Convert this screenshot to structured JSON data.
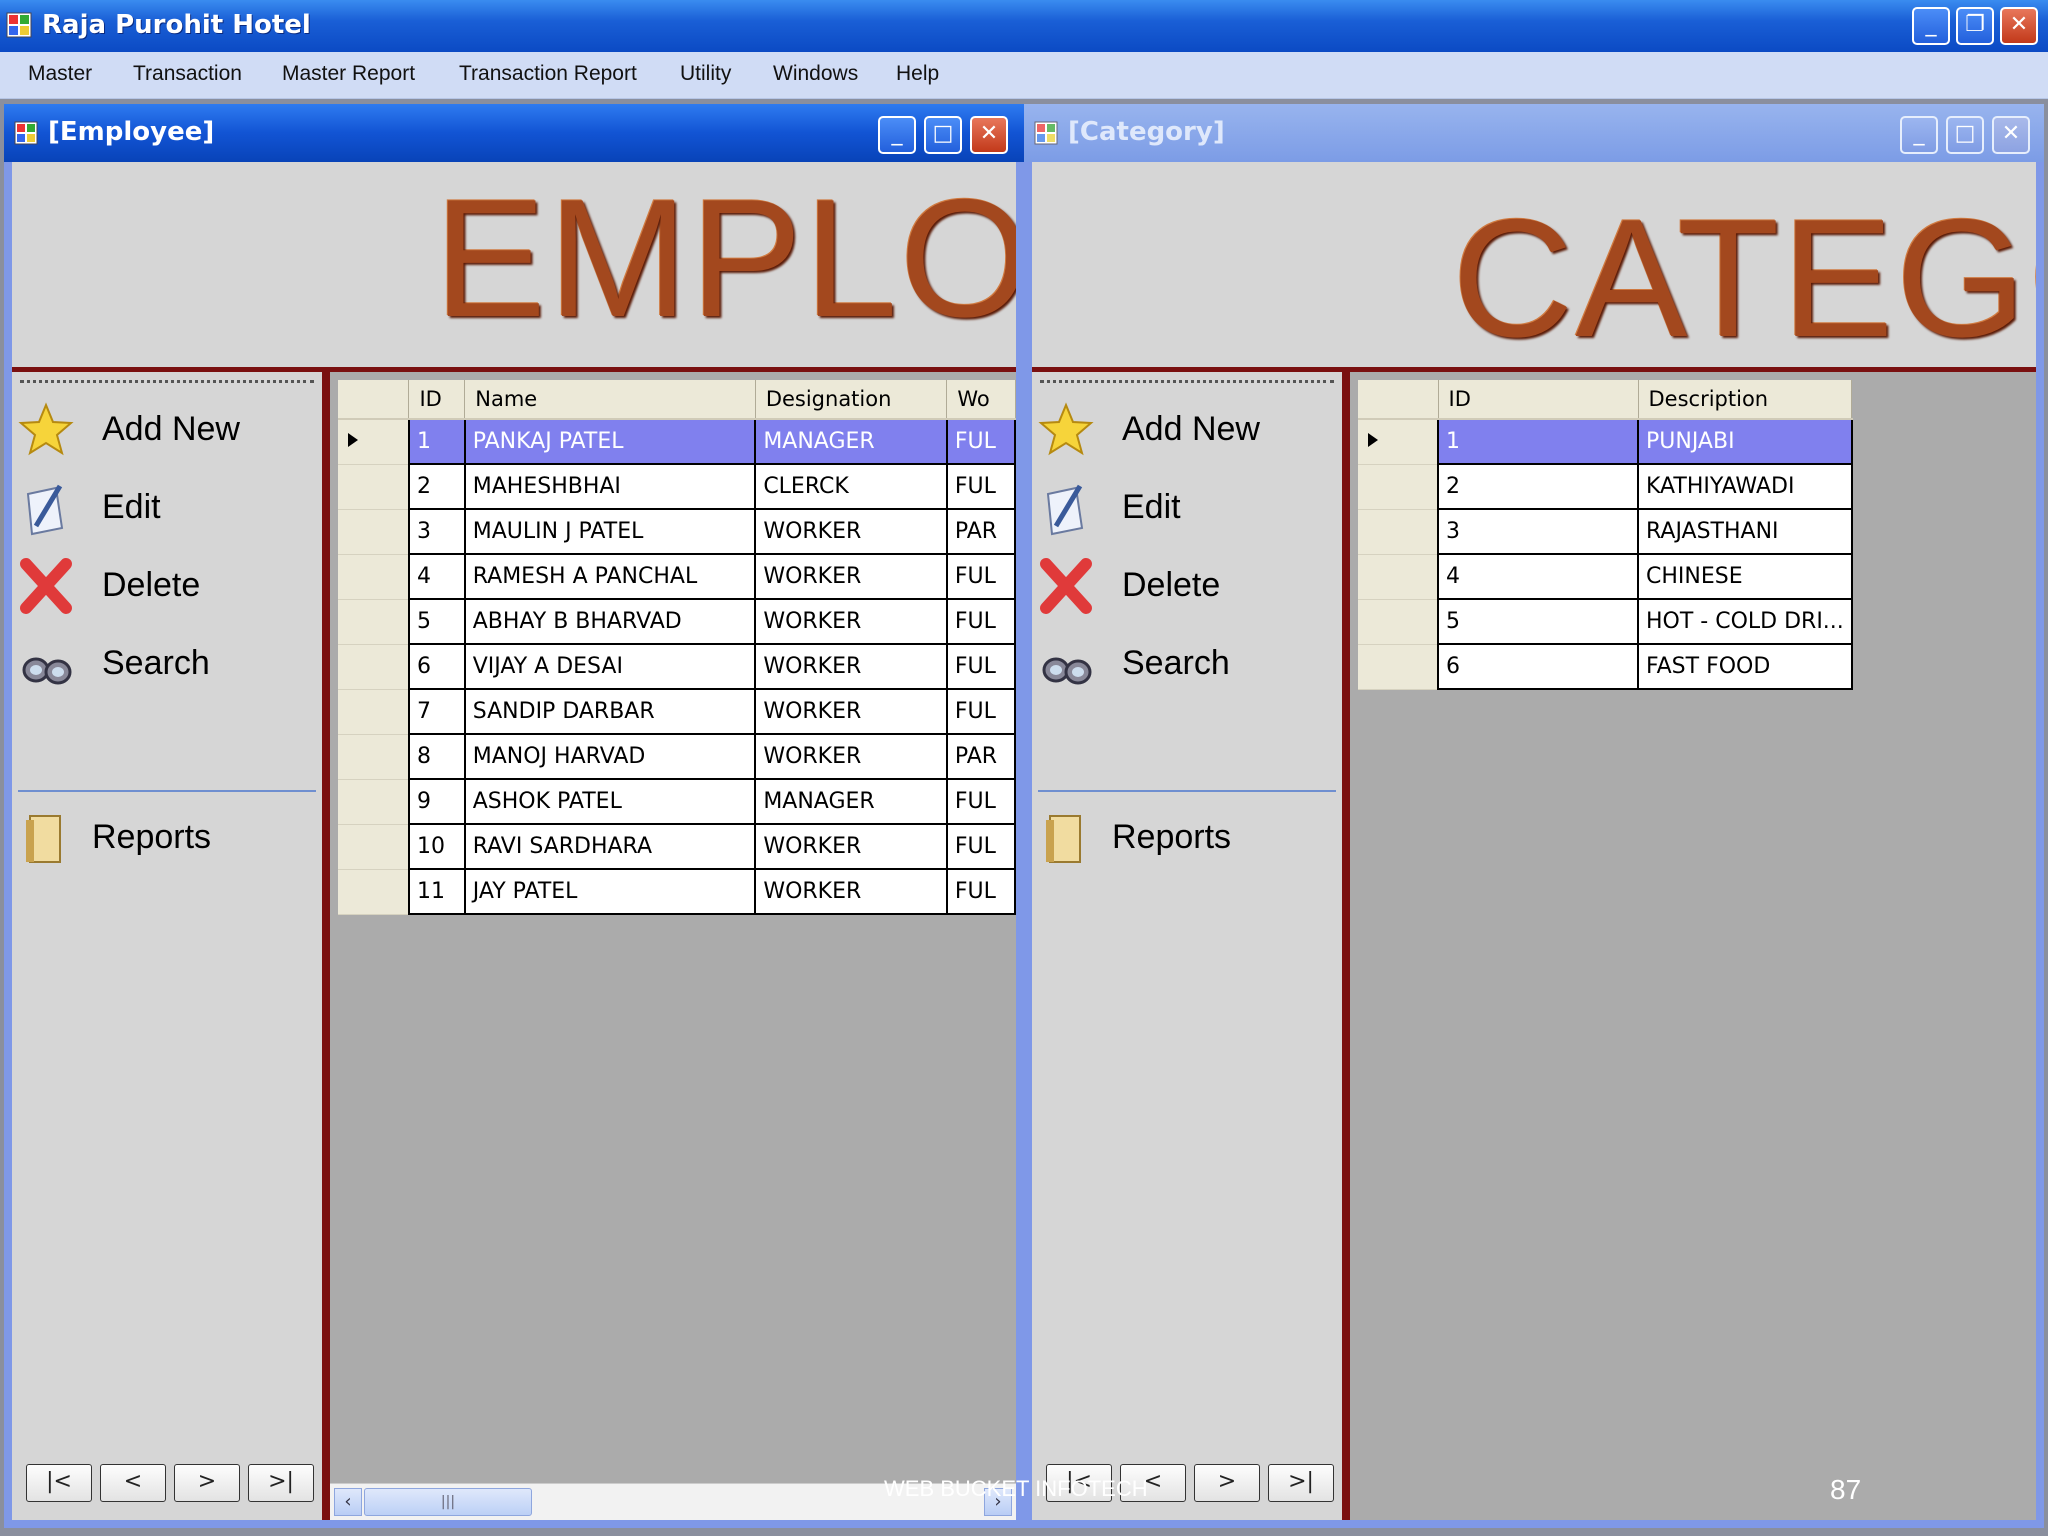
{
  "app": {
    "title": "Raja Purohit Hotel"
  },
  "menu": [
    "Master",
    "Transaction",
    "Master Report",
    "Transaction Report",
    "Utility",
    "Windows",
    "Help"
  ],
  "window_buttons": {
    "minimize": "_",
    "maximize": "□",
    "restore": "❐",
    "close": "✕"
  },
  "side": {
    "add_new": "Add New",
    "edit": "Edit",
    "delete": "Delete",
    "search": "Search",
    "reports": "Reports",
    "nav": {
      "first": "|<",
      "prev": "<",
      "next": ">",
      "last": ">|"
    }
  },
  "employee": {
    "title": "[Employee]",
    "banner": "EMPLOYEE",
    "columns": [
      "ID",
      "Name",
      "Designation",
      "Wo"
    ],
    "rows": [
      [
        "1",
        "PANKAJ PATEL",
        "MANAGER",
        "FUL"
      ],
      [
        "2",
        "MAHESHBHAI",
        "CLERCK",
        "FUL"
      ],
      [
        "3",
        "MAULIN J PATEL",
        "WORKER",
        "PAR"
      ],
      [
        "4",
        "RAMESH A PANCHAL",
        "WORKER",
        "FUL"
      ],
      [
        "5",
        "ABHAY B BHARVAD",
        "WORKER",
        "FUL"
      ],
      [
        "6",
        "VIJAY A DESAI",
        "WORKER",
        "FUL"
      ],
      [
        "7",
        "SANDIP DARBAR",
        "WORKER",
        "FUL"
      ],
      [
        "8",
        "MANOJ HARVAD",
        "WORKER",
        "PAR"
      ],
      [
        "9",
        "ASHOK PATEL",
        "MANAGER",
        "FUL"
      ],
      [
        "10",
        "RAVI SARDHARA",
        "WORKER",
        "FUL"
      ],
      [
        "11",
        "JAY PATEL",
        "WORKER",
        "FUL"
      ]
    ]
  },
  "category": {
    "title": "[Category]",
    "banner": "CATEGORY",
    "columns": [
      "ID",
      "Description"
    ],
    "rows": [
      [
        "1",
        "PUNJABI"
      ],
      [
        "2",
        "KATHIYAWADI"
      ],
      [
        "3",
        "RAJASTHANI"
      ],
      [
        "4",
        "CHINESE"
      ],
      [
        "5",
        "HOT - COLD DRI..."
      ],
      [
        "6",
        "FAST FOOD"
      ]
    ]
  },
  "footer": {
    "watermark": "WEB BUCKET INFOTECH",
    "page_number": "87"
  },
  "colors": {
    "selected_row": "#8080ee",
    "banner_text": "#a3481e",
    "frame_red": "#7a1010"
  }
}
